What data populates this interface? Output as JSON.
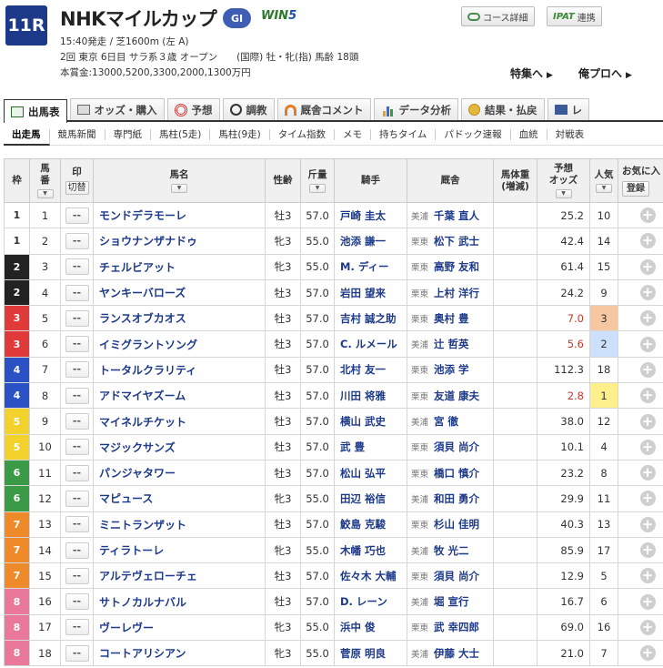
{
  "header": {
    "race_no": "11R",
    "race_name": "NHKマイルカップ",
    "grade": "GI",
    "win5_a": "WIN",
    "win5_b": "5",
    "line1": "15:40発走 / 芝1600m (左 A)",
    "line2": "2回 東京 6日目 サラ系３歳 オープン　　(国際) 牡・牝(指) 馬齢 18頭",
    "line3": "本賞金:13000,5200,3300,2000,1300万円",
    "course_btn": "コース詳細",
    "ipat_logo": "IPAT",
    "ipat_btn": "連携",
    "link_special": "特集へ",
    "link_pro": "俺プロへ"
  },
  "tabs": [
    {
      "label": "出馬表",
      "icon": "table-icon",
      "active": true
    },
    {
      "label": "オッズ・購入",
      "icon": "ticket-icon",
      "active": false
    },
    {
      "label": "予想",
      "icon": "target-icon",
      "active": false
    },
    {
      "label": "調教",
      "icon": "stopwatch-icon",
      "active": false
    },
    {
      "label": "厩舎コメント",
      "icon": "horseshoe-icon",
      "active": false
    },
    {
      "label": "データ分析",
      "icon": "bar-chart-icon",
      "active": false
    },
    {
      "label": "結果・払戻",
      "icon": "coins-icon",
      "active": false
    },
    {
      "label": "レ",
      "icon": "video-icon",
      "active": false
    }
  ],
  "subnav": [
    "出走馬",
    "競馬新聞",
    "専門紙",
    "馬柱(5走)",
    "馬柱(9走)",
    "タイム指数",
    "メモ",
    "持ちタイム",
    "パドック速報",
    "血統",
    "対戦表"
  ],
  "columns": {
    "waku": "枠",
    "umaban_a": "馬",
    "umaban_b": "番",
    "mark": "印",
    "mark_btn": "切替",
    "name": "馬名",
    "sex_age": "性齢",
    "kinryo": "斤量",
    "jockey": "騎手",
    "trainer": "厩舎",
    "weight_a": "馬体重",
    "weight_b": "(増減)",
    "odds_a": "予想",
    "odds_b": "オッズ",
    "ninki": "人気",
    "fav": "お気に入",
    "fav_btn": "登録",
    "sort": "▼"
  },
  "waku_colors": {
    "1": {
      "bg": "#ffffff",
      "fg": "#333333"
    },
    "2": {
      "bg": "#222222",
      "fg": "#ffffff"
    },
    "3": {
      "bg": "#e03a3a",
      "fg": "#ffffff"
    },
    "4": {
      "bg": "#2b52c4",
      "fg": "#ffffff"
    },
    "5": {
      "bg": "#f4d22c",
      "fg": "#ffffff"
    },
    "6": {
      "bg": "#3a9a45",
      "fg": "#ffffff"
    },
    "7": {
      "bg": "#ef8a2a",
      "fg": "#ffffff"
    },
    "8": {
      "bg": "#e9789a",
      "fg": "#ffffff"
    }
  },
  "ninki_colors": {
    "1": "#fdf08a",
    "2": "#cde0fb",
    "3": "#f7c7a1"
  },
  "mark_placeholder": "--",
  "fav_icon": "plus-icon",
  "horses": [
    {
      "waku": "1",
      "umaban": "1",
      "name": "モンドデラモーレ",
      "sex_age": "牡3",
      "kinryo": "57.0",
      "jockey": "戸崎 圭太",
      "area": "美浦",
      "trainer": "千葉 直人",
      "odds": "25.2",
      "ninki": "10"
    },
    {
      "waku": "1",
      "umaban": "2",
      "name": "ショウナンザナドゥ",
      "sex_age": "牝3",
      "kinryo": "55.0",
      "jockey": "池添 謙一",
      "area": "栗東",
      "trainer": "松下 武士",
      "odds": "42.4",
      "ninki": "14"
    },
    {
      "waku": "2",
      "umaban": "3",
      "name": "チェルビアット",
      "sex_age": "牝3",
      "kinryo": "55.0",
      "jockey": "M. ディー",
      "area": "栗東",
      "trainer": "高野 友和",
      "odds": "61.4",
      "ninki": "15"
    },
    {
      "waku": "2",
      "umaban": "4",
      "name": "ヤンキーバローズ",
      "sex_age": "牡3",
      "kinryo": "57.0",
      "jockey": "岩田 望来",
      "area": "栗東",
      "trainer": "上村 洋行",
      "odds": "24.2",
      "ninki": "9"
    },
    {
      "waku": "3",
      "umaban": "5",
      "name": "ランスオブカオス",
      "sex_age": "牡3",
      "kinryo": "57.0",
      "jockey": "吉村 誠之助",
      "area": "栗東",
      "trainer": "奥村 豊",
      "odds": "7.0",
      "ninki": "3"
    },
    {
      "waku": "3",
      "umaban": "6",
      "name": "イミグラントソング",
      "sex_age": "牡3",
      "kinryo": "57.0",
      "jockey": "C. ルメール",
      "area": "美浦",
      "trainer": "辻 哲英",
      "odds": "5.6",
      "ninki": "2"
    },
    {
      "waku": "4",
      "umaban": "7",
      "name": "トータルクラリティ",
      "sex_age": "牡3",
      "kinryo": "57.0",
      "jockey": "北村 友一",
      "area": "栗東",
      "trainer": "池添 学",
      "odds": "112.3",
      "ninki": "18"
    },
    {
      "waku": "4",
      "umaban": "8",
      "name": "アドマイヤズーム",
      "sex_age": "牡3",
      "kinryo": "57.0",
      "jockey": "川田 将雅",
      "area": "栗東",
      "trainer": "友道 康夫",
      "odds": "2.8",
      "ninki": "1"
    },
    {
      "waku": "5",
      "umaban": "9",
      "name": "マイネルチケット",
      "sex_age": "牡3",
      "kinryo": "57.0",
      "jockey": "横山 武史",
      "area": "美浦",
      "trainer": "宮 徹",
      "odds": "38.0",
      "ninki": "12"
    },
    {
      "waku": "5",
      "umaban": "10",
      "name": "マジックサンズ",
      "sex_age": "牡3",
      "kinryo": "57.0",
      "jockey": "武 豊",
      "area": "栗東",
      "trainer": "須貝 尚介",
      "odds": "10.1",
      "ninki": "4"
    },
    {
      "waku": "6",
      "umaban": "11",
      "name": "パンジャタワー",
      "sex_age": "牡3",
      "kinryo": "57.0",
      "jockey": "松山 弘平",
      "area": "栗東",
      "trainer": "橋口 慎介",
      "odds": "23.2",
      "ninki": "8"
    },
    {
      "waku": "6",
      "umaban": "12",
      "name": "マピュース",
      "sex_age": "牝3",
      "kinryo": "55.0",
      "jockey": "田辺 裕信",
      "area": "美浦",
      "trainer": "和田 勇介",
      "odds": "29.9",
      "ninki": "11"
    },
    {
      "waku": "7",
      "umaban": "13",
      "name": "ミニトランザット",
      "sex_age": "牡3",
      "kinryo": "57.0",
      "jockey": "鮫島 克駿",
      "area": "栗東",
      "trainer": "杉山 佳明",
      "odds": "40.3",
      "ninki": "13"
    },
    {
      "waku": "7",
      "umaban": "14",
      "name": "ティラトーレ",
      "sex_age": "牝3",
      "kinryo": "55.0",
      "jockey": "木幡 巧也",
      "area": "美浦",
      "trainer": "牧 光二",
      "odds": "85.9",
      "ninki": "17"
    },
    {
      "waku": "7",
      "umaban": "15",
      "name": "アルテヴェローチェ",
      "sex_age": "牡3",
      "kinryo": "57.0",
      "jockey": "佐々木 大輔",
      "area": "栗東",
      "trainer": "須貝 尚介",
      "odds": "12.9",
      "ninki": "5"
    },
    {
      "waku": "8",
      "umaban": "16",
      "name": "サトノカルナバル",
      "sex_age": "牡3",
      "kinryo": "57.0",
      "jockey": "D. レーン",
      "area": "美浦",
      "trainer": "堀 宣行",
      "odds": "16.7",
      "ninki": "6"
    },
    {
      "waku": "8",
      "umaban": "17",
      "name": "ヴーレヴー",
      "sex_age": "牝3",
      "kinryo": "55.0",
      "jockey": "浜中 俊",
      "area": "栗東",
      "trainer": "武 幸四郎",
      "odds": "69.0",
      "ninki": "16"
    },
    {
      "waku": "8",
      "umaban": "18",
      "name": "コートアリシアン",
      "sex_age": "牝3",
      "kinryo": "55.0",
      "jockey": "菅原 明良",
      "area": "美浦",
      "trainer": "伊藤 大士",
      "odds": "21.0",
      "ninki": "7"
    }
  ]
}
